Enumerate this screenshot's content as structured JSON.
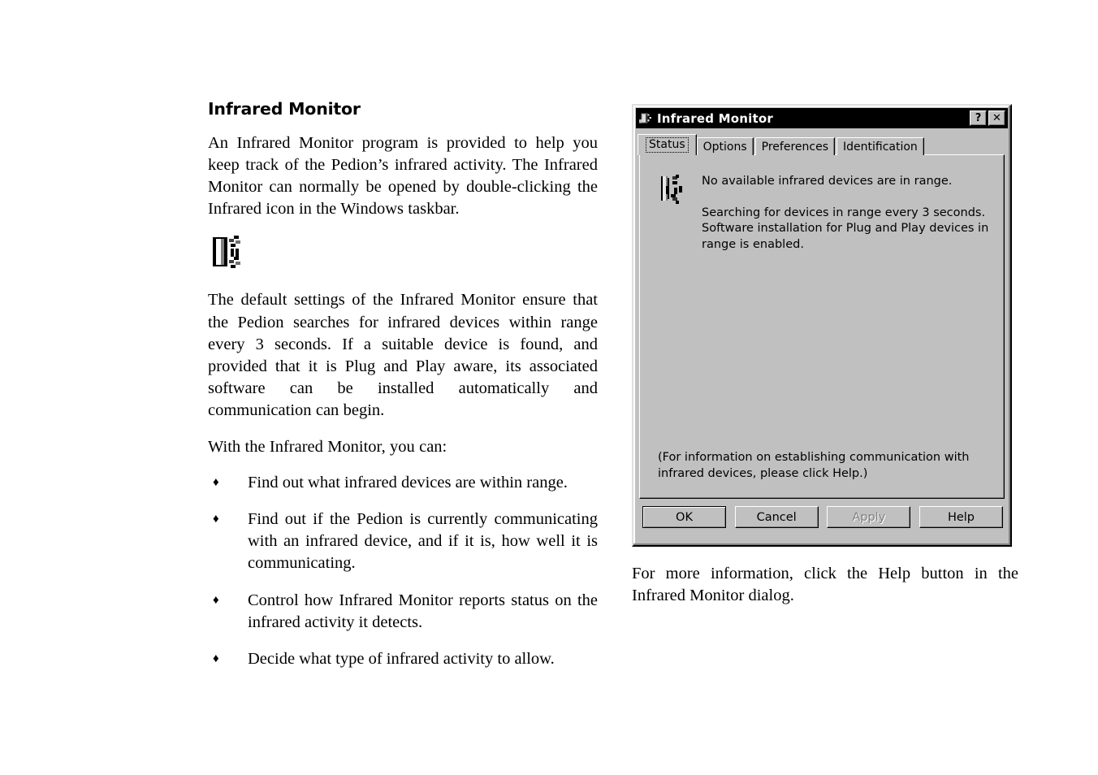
{
  "document": {
    "heading": "Infrared Monitor",
    "paragraphs": {
      "intro": "An Infrared Monitor program is provided to help you keep track of the Pedion’s infrared activity. The Infrared Monitor can normally be opened by double-clicking the Infrared icon in the Windows taskbar.",
      "defaults_pre": "The default settings of the Infrared Monitor ensure that the Pedion searches for infrared devices within range every 3 seconds. If a suitable device is found, and provided that it is ",
      "defaults_nobreak": "Plug and Play",
      "defaults_post": " aware, its associated software can be installed automatically and communication can begin.",
      "intro_list": "With the Infrared Monitor, you can:",
      "caption": "For more information, click the Help button in the Infrared Monitor dialog."
    },
    "inline_icon_name": "infrared-taskbar-icon",
    "bullet_marker": "♦",
    "bullets": [
      "Find out what infrared devices are within range.",
      "Find out if the Pedion is currently communicating with an infrared device, and if it is, how well it is communicating.",
      "Control how Infrared Monitor reports status on the infrared activity it detects.",
      "Decide what type of infrared activity to allow."
    ]
  },
  "dialog": {
    "title": "Infrared Monitor",
    "title_icon": "infrared-monitor-icon",
    "title_buttons": [
      {
        "label": "?",
        "name": "help-context-button"
      },
      {
        "label": "✕",
        "name": "close-button"
      }
    ],
    "tabs": [
      {
        "label": "Status",
        "active": true
      },
      {
        "label": "Options",
        "active": false
      },
      {
        "label": "Preferences",
        "active": false
      },
      {
        "label": "Identification",
        "active": false
      }
    ],
    "status": {
      "icon": "infrared-signal-icon",
      "headline": "No available infrared devices are in range.",
      "detail": "Searching for devices in range every 3 seconds. Software installation for Plug and Play devices in range is enabled.",
      "help_note": "(For information on establishing communication with infrared devices, please click Help.)"
    },
    "buttons": [
      {
        "label": "OK",
        "name": "ok-button",
        "default": true,
        "disabled": false
      },
      {
        "label": "Cancel",
        "name": "cancel-button",
        "default": false,
        "disabled": false
      },
      {
        "label": "Apply",
        "name": "apply-button",
        "default": false,
        "disabled": true
      },
      {
        "label": "Help",
        "name": "help-button",
        "default": false,
        "disabled": false
      }
    ]
  },
  "colors": {
    "page_background": "#ffffff",
    "text": "#000000",
    "dialog_face": "#c0c0c0",
    "dialog_shadow": "#808080",
    "dialog_highlight": "#ffffff",
    "titlebar_background": "#000000",
    "titlebar_text": "#ffffff",
    "disabled_text": "#808080"
  }
}
